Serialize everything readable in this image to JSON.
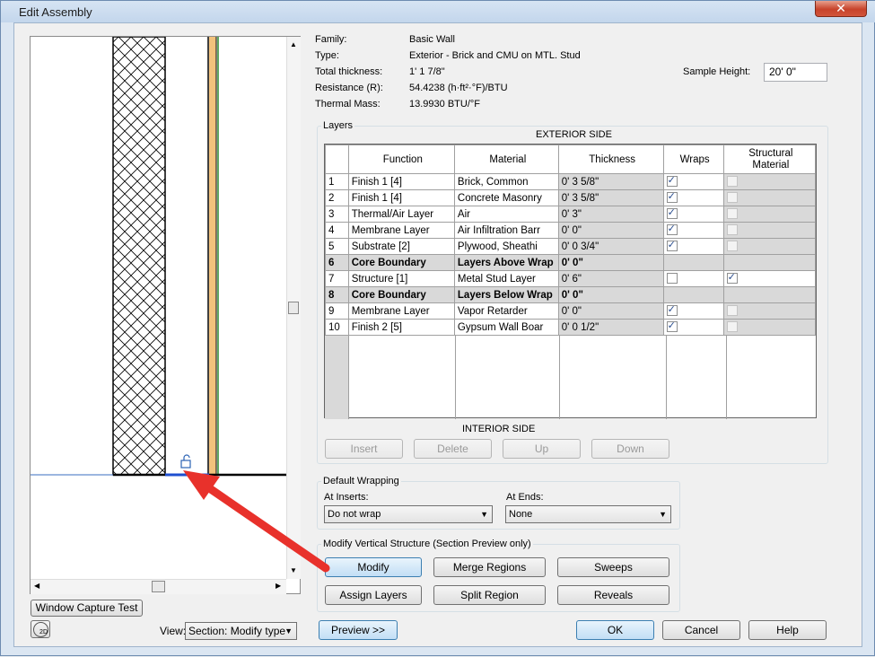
{
  "window": {
    "title": "Edit Assembly",
    "close_glyph": "✕"
  },
  "info": {
    "family_label": "Family:",
    "family_value": "Basic Wall",
    "type_label": "Type:",
    "type_value": "Exterior - Brick and CMU on MTL. Stud",
    "thickness_label": "Total thickness:",
    "thickness_value": "1'  1 7/8\"",
    "resistance_label": "Resistance (R):",
    "resistance_value": "54.4238 (h·ft²·°F)/BTU",
    "mass_label": "Thermal Mass:",
    "mass_value": "13.9930 BTU/°F",
    "sample_height_label": "Sample Height:",
    "sample_height_value": "20'  0\""
  },
  "layers": {
    "group_title": "Layers",
    "exterior_label": "EXTERIOR SIDE",
    "interior_label": "INTERIOR SIDE",
    "columns": [
      "Function",
      "Material",
      "Thickness",
      "Wraps",
      "Structural\nMaterial"
    ],
    "rows": [
      {
        "n": "1",
        "function": "Finish 1 [4]",
        "material": "Brick, Common",
        "thickness": "0'  3 5/8\"",
        "wraps": true,
        "structural": false,
        "core": false
      },
      {
        "n": "2",
        "function": "Finish 1 [4]",
        "material": "Concrete Masonry",
        "thickness": "0'  3 5/8\"",
        "wraps": true,
        "structural": false,
        "core": false
      },
      {
        "n": "3",
        "function": "Thermal/Air Layer",
        "material": "Air",
        "thickness": "0'  3\"",
        "wraps": true,
        "structural": false,
        "core": false
      },
      {
        "n": "4",
        "function": "Membrane Layer",
        "material": "Air Infiltration Barr",
        "thickness": "0'  0\"",
        "wraps": true,
        "structural": false,
        "core": false
      },
      {
        "n": "5",
        "function": "Substrate [2]",
        "material": "Plywood, Sheathi",
        "thickness": "0'  0 3/4\"",
        "wraps": true,
        "structural": false,
        "core": false
      },
      {
        "n": "6",
        "function": "Core Boundary",
        "material": "Layers Above Wrap",
        "thickness": "0'  0\"",
        "wraps": null,
        "structural": null,
        "core": true
      },
      {
        "n": "7",
        "function": "Structure [1]",
        "material": "Metal Stud Layer",
        "thickness": "0'  6\"",
        "wraps": false,
        "structural": true,
        "core": false
      },
      {
        "n": "8",
        "function": "Core Boundary",
        "material": "Layers Below Wrap",
        "thickness": "0'  0\"",
        "wraps": null,
        "structural": null,
        "core": true
      },
      {
        "n": "9",
        "function": "Membrane Layer",
        "material": "Vapor Retarder",
        "thickness": "0'  0\"",
        "wraps": true,
        "structural": false,
        "core": false
      },
      {
        "n": "10",
        "function": "Finish 2 [5]",
        "material": "Gypsum Wall Boar",
        "thickness": "0'  0 1/2\"",
        "wraps": true,
        "structural": false,
        "core": false
      }
    ],
    "buttons": {
      "insert": "Insert",
      "delete": "Delete",
      "up": "Up",
      "down": "Down"
    }
  },
  "wrapping": {
    "group_title": "Default Wrapping",
    "inserts_label": "At Inserts:",
    "inserts_value": "Do not wrap",
    "ends_label": "At  Ends:",
    "ends_value": "None"
  },
  "modify": {
    "group_title": "Modify Vertical Structure (Section Preview only)",
    "modify": "Modify",
    "merge": "Merge Regions",
    "sweeps": "Sweeps",
    "assign": "Assign Layers",
    "split": "Split Region",
    "reveals": "Reveals"
  },
  "preview": {
    "window_capture": "Window Capture Test",
    "view_label": "View:",
    "view_value": "Section: Modify type",
    "preview_button": "Preview >>",
    "twod_icon_text": "2D"
  },
  "footer": {
    "ok": "OK",
    "cancel": "Cancel",
    "help": "Help"
  },
  "colors": {
    "accent": "#e8312b",
    "finish_orange": "#f2c27c",
    "membrane_green": "#2f8a2f"
  }
}
